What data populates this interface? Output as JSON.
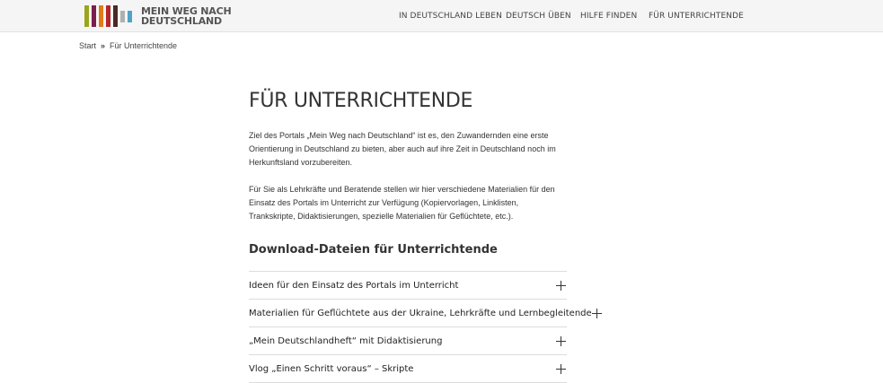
{
  "header": {
    "logo": {
      "line1": "MEIN WEG NACH",
      "line2": "DEUTSCHLAND",
      "bar_colors": [
        "#9aa51b",
        "#7a1f4d",
        "#e07b1a",
        "#b3262b",
        "#4b2a24",
        "#b0b0b0",
        "#4fa3c7"
      ]
    },
    "nav": [
      {
        "label": "IN DEUTSCHLAND LEBEN"
      },
      {
        "label": "DEUTSCH ÜBEN"
      },
      {
        "label": "HILFE FINDEN"
      },
      {
        "label": "FÜR UNTERRICHTENDE"
      }
    ]
  },
  "breadcrumb": {
    "home": "Start",
    "separator": "»",
    "current": "Für Unterrichtende"
  },
  "main": {
    "title": "FÜR UNTERRICHTENDE",
    "paragraphs": [
      "Ziel des Portals „Mein Weg nach Deutschland“ ist es, den Zuwandernden eine erste Orientierung in Deutschland zu bieten, aber auch auf ihre Zeit in Deutschland noch im Herkunftsland vorzubereiten.",
      "Für Sie als Lehrkräfte und Beratende stellen wir hier verschiedene Materialien für den Einsatz des Portals im Unterricht zur Verfügung (Kopiervorlagen, Linklisten, Trankskripte, Didaktisierungen, spezielle Materialien für Geflüchtete, etc.)."
    ],
    "section_title": "Download-Dateien für Unterrichtende",
    "accordion": [
      {
        "label": "Ideen für den Einsatz des Portals im Unterricht",
        "icon": "plus-icon"
      },
      {
        "label": "Materialien für Geflüchtete aus der Ukraine, Lehrkräfte und Lernbegleitende",
        "icon": "plus-icon"
      },
      {
        "label": "„Mein Deutschlandheft“ mit Didaktisierung",
        "icon": "plus-icon"
      },
      {
        "label": "Vlog „Einen Schritt voraus“ – Skripte",
        "icon": "plus-icon"
      }
    ]
  }
}
